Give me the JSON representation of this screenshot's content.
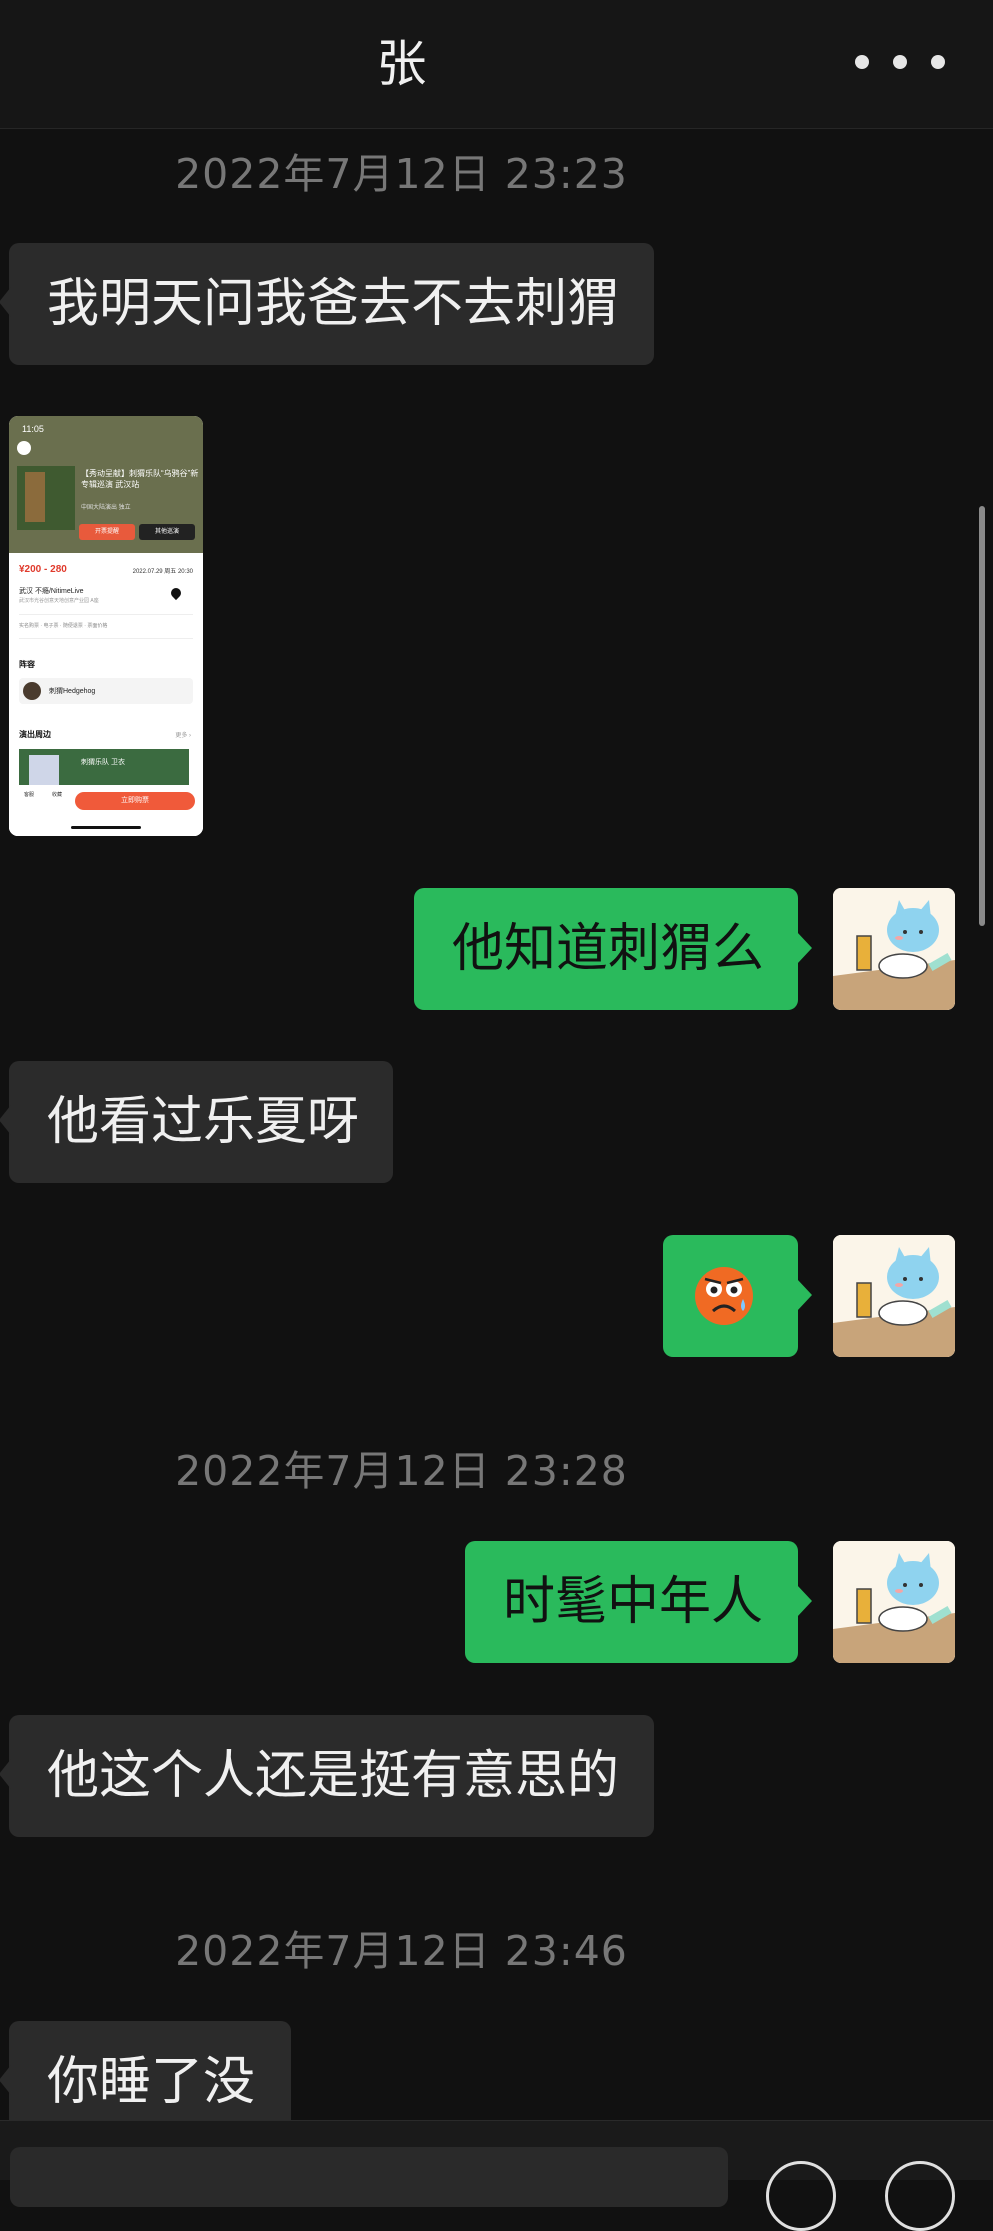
{
  "header": {
    "title": "张"
  },
  "messages": {
    "ts1": "2022年7月12日 23:23",
    "m1": "我明天问我爸去不去刺猬",
    "shot": {
      "status_time": "11:05",
      "headline": "【秀动呈献】刺猬乐队“乌鸦谷”新专辑巡演 武汉站",
      "sub": "中国大陆演出 独立",
      "btn1": "开票提醒",
      "btn2": "其他巡演",
      "price": "¥200 - 280",
      "date": "2022.07.29 周五 20:30",
      "venue": "武汉 不瘾/NitimeLive",
      "venue_addr": "武汉市光谷创意天地创意产业园 A座",
      "tags": "实名购票 · 电子票 · 随便退票 · 票面价格",
      "lineup_title": "阵容",
      "artist": "刺猬Hedgehog",
      "merch_title": "演出周边",
      "merch_more": "更多 ›",
      "merch_item": "刺猬乐队 卫衣",
      "nav1": "客服",
      "nav2": "收藏",
      "buy": "立即购票"
    },
    "m2": "他知道刺猬么",
    "m3": "他看过乐夏呀",
    "ts2": "2022年7月12日 23:28",
    "m5": "时髦中年人",
    "m6": "他这个人还是挺有意思的",
    "ts3": "2022年7月12日 23:46",
    "m7": "你睡了没"
  },
  "icons": {
    "more": "more-dots-icon",
    "avatar": "cat-avatar-icon",
    "sticker": "worried-face-emoji-icon"
  },
  "colors": {
    "background": "#111111",
    "incoming_bubble": "#2b2b2b",
    "outgoing_bubble": "#2aba5c"
  }
}
